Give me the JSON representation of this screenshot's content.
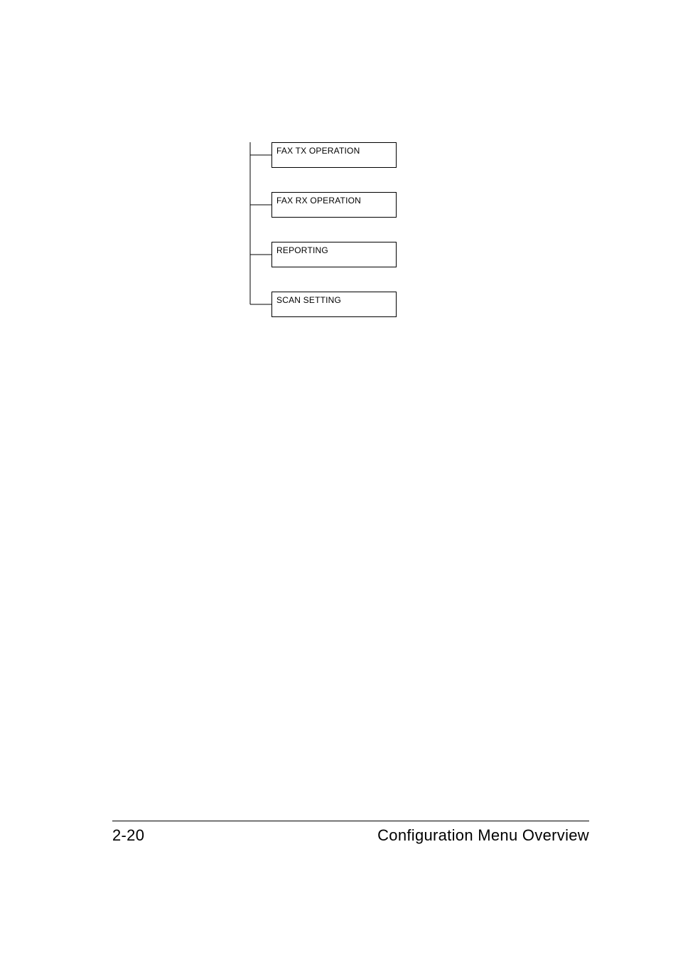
{
  "tree": {
    "items": [
      {
        "label": "FAX TX OPERATION"
      },
      {
        "label": "FAX RX OPERATION"
      },
      {
        "label": "REPORTING"
      },
      {
        "label": "SCAN SETTING"
      }
    ]
  },
  "footer": {
    "page_number": "2-20",
    "section_title": "Configuration Menu Overview"
  }
}
